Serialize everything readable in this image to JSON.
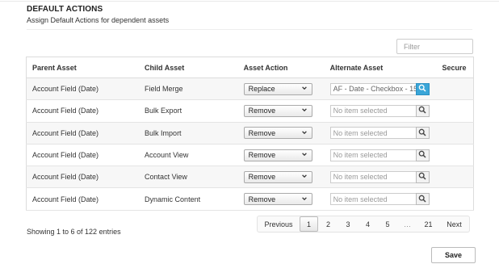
{
  "section": {
    "title": "DEFAULT ACTIONS",
    "subtitle": "Assign Default Actions for dependent assets"
  },
  "filter": {
    "placeholder": "Filter",
    "value": ""
  },
  "table": {
    "columns": [
      "Parent Asset",
      "Child Asset",
      "Asset Action",
      "Alternate Asset",
      "Secure"
    ],
    "rows": [
      {
        "parent": "Account Field (Date)",
        "child": "Field Merge",
        "action": "Replace",
        "alternate": "AF - Date - Checkbox - 15",
        "alternate_selected": true
      },
      {
        "parent": "Account Field (Date)",
        "child": "Bulk Export",
        "action": "Remove",
        "alternate": "No item selected",
        "alternate_selected": false
      },
      {
        "parent": "Account Field (Date)",
        "child": "Bulk Import",
        "action": "Remove",
        "alternate": "No item selected",
        "alternate_selected": false
      },
      {
        "parent": "Account Field (Date)",
        "child": "Account View",
        "action": "Remove",
        "alternate": "No item selected",
        "alternate_selected": false
      },
      {
        "parent": "Account Field (Date)",
        "child": "Contact View",
        "action": "Remove",
        "alternate": "No item selected",
        "alternate_selected": false
      },
      {
        "parent": "Account Field (Date)",
        "child": "Dynamic Content",
        "action": "Remove",
        "alternate": "No item selected",
        "alternate_selected": false
      }
    ]
  },
  "status_text": "Showing 1 to 6 of 122 entries",
  "pagination": {
    "previous": "Previous",
    "pages": [
      "1",
      "2",
      "3",
      "4",
      "5",
      "…",
      "21"
    ],
    "current": "1",
    "next": "Next"
  },
  "save_label": "Save",
  "colors": {
    "search_active": "#3aa6d8",
    "row_stripe": "#f7f7f7",
    "border": "#dcdcdc"
  },
  "icons": {
    "search": "magnifier-icon",
    "dropdown": "chevron-down-icon"
  }
}
